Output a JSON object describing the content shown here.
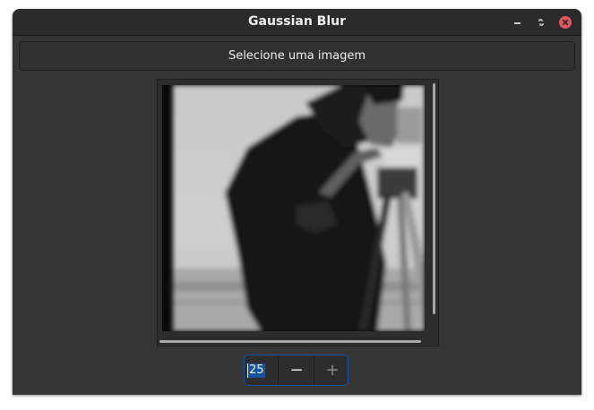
{
  "window": {
    "title": "Gaussian Blur",
    "controls": [
      "minimize-icon",
      "maximize-icon",
      "close-icon"
    ],
    "close_color": "#e25561"
  },
  "main": {
    "select_button_label": "Selecione uma imagem",
    "image_description_alt": "Imagem em tons de cinza (homem com câmera) desfocada",
    "spin": {
      "value": "25",
      "minus_label": "−",
      "plus_label": "+"
    }
  },
  "colors": {
    "window_bg": "#353535",
    "titlebar_bg": "#2b2b2b",
    "accent": "#15539e",
    "text": "#eeeeec"
  }
}
